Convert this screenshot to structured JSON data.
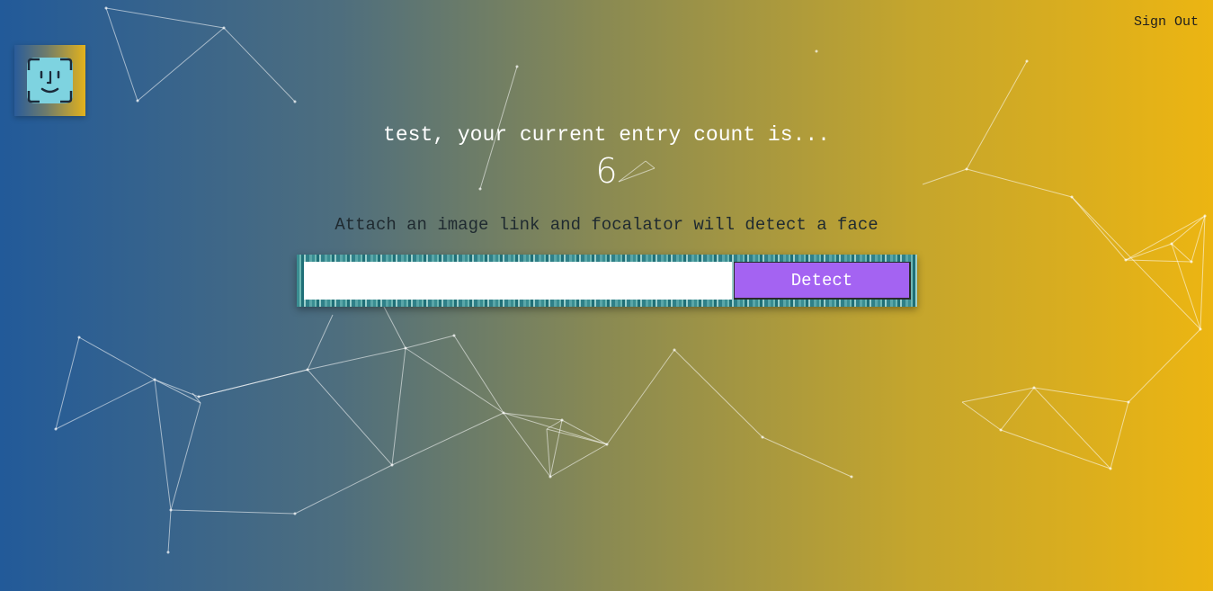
{
  "header": {
    "logo_icon": "face-id-icon",
    "sign_out_label": "Sign Out"
  },
  "rank": {
    "greeting": "test, your current entry count is...",
    "entry_count": "6"
  },
  "form": {
    "instructions": "Attach an image link and focalator will detect a face",
    "url_value": "",
    "url_placeholder": "",
    "detect_label": "Detect"
  },
  "colors": {
    "gradient_start": "#225a99",
    "gradient_end": "#ecb512",
    "button": "#a463f2",
    "panel": "#3a8e92",
    "logo_face": "#7ed3e0"
  }
}
